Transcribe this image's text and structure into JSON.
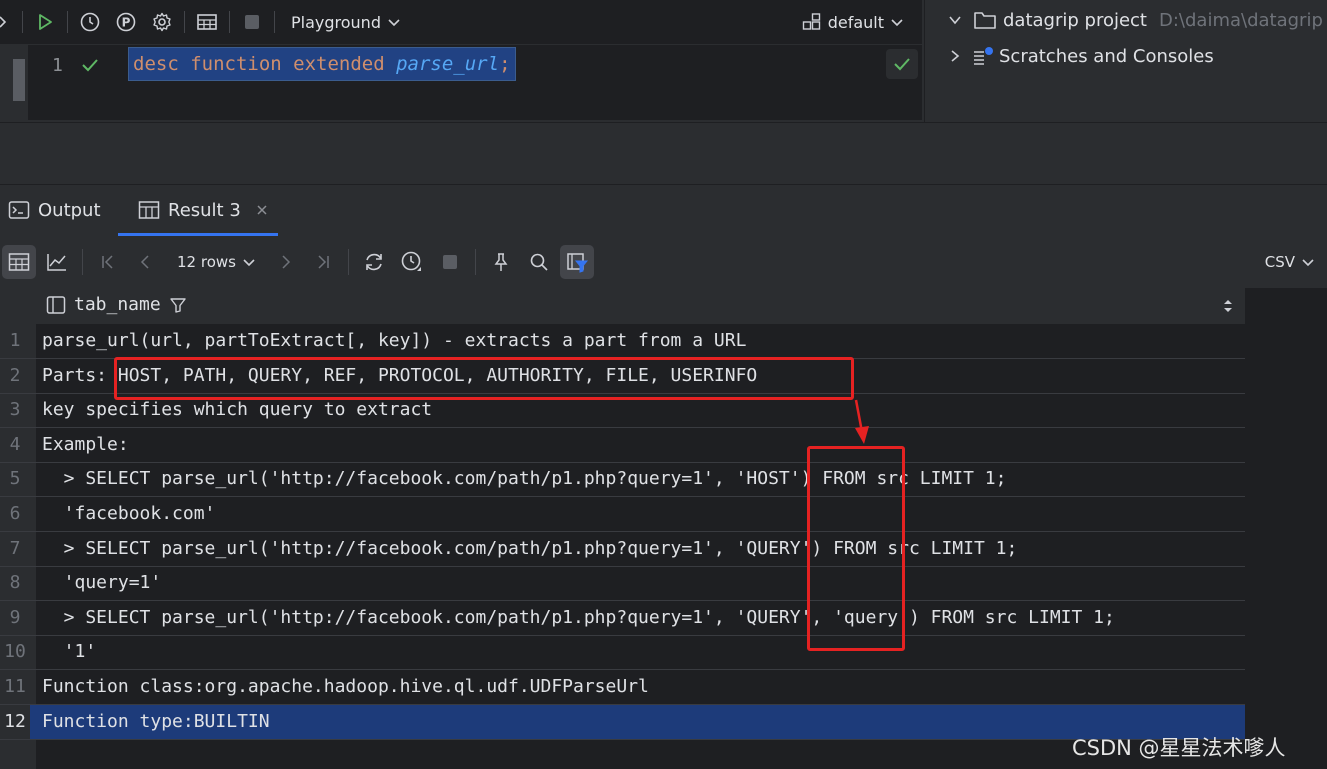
{
  "editor_toolbar": {
    "session": "Playground",
    "schema": "default"
  },
  "editor": {
    "line_number": "1",
    "keywords": "desc function extended ",
    "function_name": "parse_url",
    "terminator": ";"
  },
  "project_tree": {
    "project_name": "datagrip project",
    "project_path": "D:\\daima\\datagrip",
    "scratches": "Scratches and Consoles"
  },
  "tool_tabs": {
    "output": "Output",
    "result": "Result 3"
  },
  "result_toolbar": {
    "rows_label": "12 rows",
    "export_format": "CSV"
  },
  "grid": {
    "column": "tab_name",
    "rows": [
      {
        "n": "1",
        "text": "parse_url(url, partToExtract[, key]) - extracts a part from a URL"
      },
      {
        "n": "2",
        "text": "Parts: HOST, PATH, QUERY, REF, PROTOCOL, AUTHORITY, FILE, USERINFO"
      },
      {
        "n": "3",
        "text": "key specifies which query to extract"
      },
      {
        "n": "4",
        "text": "Example:"
      },
      {
        "n": "5",
        "text": "  > SELECT parse_url('http://facebook.com/path/p1.php?query=1', 'HOST') FROM src LIMIT 1;"
      },
      {
        "n": "6",
        "text": "  'facebook.com'"
      },
      {
        "n": "7",
        "text": "  > SELECT parse_url('http://facebook.com/path/p1.php?query=1', 'QUERY') FROM src LIMIT 1;"
      },
      {
        "n": "8",
        "text": "  'query=1'"
      },
      {
        "n": "9",
        "text": "  > SELECT parse_url('http://facebook.com/path/p1.php?query=1', 'QUERY', 'query') FROM src LIMIT 1;"
      },
      {
        "n": "10",
        "text": "  '1'"
      },
      {
        "n": "11",
        "text": "Function class:org.apache.hadoop.hive.ql.udf.UDFParseUrl"
      },
      {
        "n": "12",
        "text": "Function type:BUILTIN"
      }
    ],
    "selected_row": "12"
  },
  "watermark": "CSDN @星星法术嗲人",
  "colors": {
    "keyword": "#cf8e6d",
    "function": "#56a8f5",
    "selection": "#214283",
    "annotation": "#e52222",
    "success": "#5fb865"
  }
}
